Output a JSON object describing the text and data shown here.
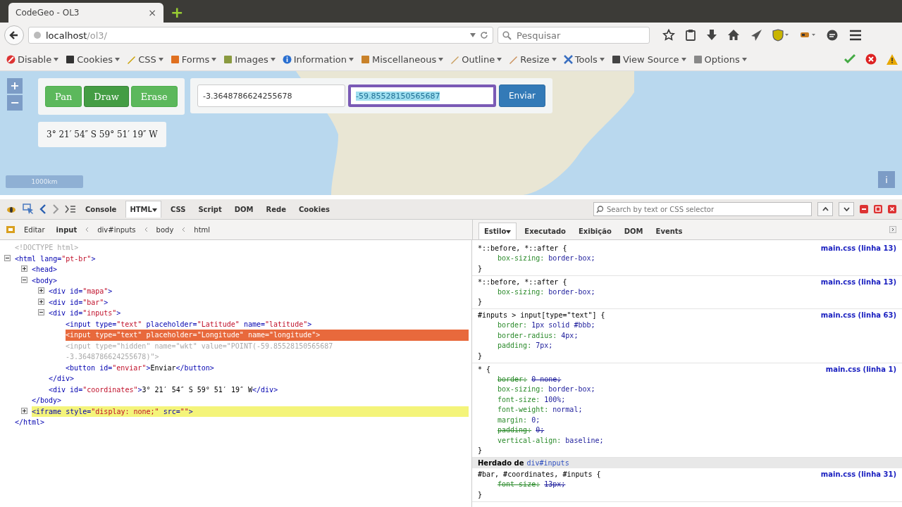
{
  "browser": {
    "tab_title": "CodeGeo - OL3",
    "tab_close": "×",
    "new_tab": "+",
    "url_host": "localhost",
    "url_path": "/ol3/",
    "search_placeholder": "Pesquisar"
  },
  "webdev_toolbar": [
    {
      "label": "Disable"
    },
    {
      "label": "Cookies"
    },
    {
      "label": "CSS"
    },
    {
      "label": "Forms"
    },
    {
      "label": "Images"
    },
    {
      "label": "Information"
    },
    {
      "label": "Miscellaneous"
    },
    {
      "label": "Outline"
    },
    {
      "label": "Resize"
    },
    {
      "label": "Tools"
    },
    {
      "label": "View Source"
    },
    {
      "label": "Options"
    }
  ],
  "map": {
    "zoom_in": "+",
    "zoom_out": "−",
    "modes": [
      {
        "label": "Pan",
        "selected": false
      },
      {
        "label": "Draw",
        "selected": true
      },
      {
        "label": "Erase",
        "selected": false
      }
    ],
    "latitude": {
      "value": "-3.3648786624255678",
      "focused": false
    },
    "longitude": {
      "value": "-59.85528150565687",
      "focused": true
    },
    "submit": "Enviar",
    "coordinates": "3° 21′ 54″ S 59° 51′ 19″ W",
    "scale": "1000km",
    "attribution": "i"
  },
  "devtools": {
    "tabs": [
      {
        "label": "Console",
        "selected": false
      },
      {
        "label": "HTML",
        "selected": true
      },
      {
        "label": "CSS",
        "selected": false
      },
      {
        "label": "Script",
        "selected": false
      },
      {
        "label": "DOM",
        "selected": false
      },
      {
        "label": "Rede",
        "selected": false
      },
      {
        "label": "Cookies",
        "selected": false
      }
    ],
    "search_placeholder": "Search by text or CSS selector",
    "edit": "Editar",
    "breadcrumbs": [
      {
        "label": "input",
        "selected": true
      },
      {
        "label": "div#inputs",
        "selected": false
      },
      {
        "label": "body",
        "selected": false
      },
      {
        "label": "html",
        "selected": false
      }
    ],
    "side_tabs": [
      {
        "label": "Estilo",
        "selected": true
      },
      {
        "label": "Executado",
        "selected": false
      },
      {
        "label": "Exibição",
        "selected": false
      },
      {
        "label": "DOM",
        "selected": false
      },
      {
        "label": "Events",
        "selected": false
      }
    ]
  },
  "html_tree": [
    {
      "line": "<!DOCTYPE html>",
      "selected": false,
      "highlighted": false,
      "dimmed": true
    },
    {
      "line": "<html lang=\"pt-br\">",
      "selected": false,
      "highlighted": false,
      "dimmed": false,
      "expanded": true,
      "close": "</html>",
      "children": [
        {
          "line": "<head>",
          "selected": false,
          "highlighted": false,
          "dimmed": false,
          "expanded": false
        },
        {
          "line": "<body>",
          "selected": false,
          "highlighted": false,
          "dimmed": false,
          "expanded": true,
          "close": "</body>",
          "children": [
            {
              "line": "<div id=\"mapa\">",
              "selected": false,
              "highlighted": false,
              "dimmed": false,
              "expanded": false
            },
            {
              "line": "<div id=\"bar\">",
              "selected": false,
              "highlighted": false,
              "dimmed": false,
              "expanded": false
            },
            {
              "line": "<div id=\"inputs\">",
              "selected": false,
              "highlighted": false,
              "dimmed": false,
              "expanded": true,
              "close": "</div>",
              "children": [
                {
                  "line": "<input type=\"text\" placeholder=\"Latitude\" name=\"latitude\">",
                  "selected": false,
                  "highlighted": false,
                  "dimmed": false
                },
                {
                  "line": "<input type=\"text\" placeholder=\"Longitude\" name=\"longitude\">",
                  "selected": true,
                  "highlighted": false,
                  "dimmed": false
                },
                {
                  "line": "<input type=\"hidden\" name=\"wkt\" value=\"POINT(-59.85528150565687 -3.3648786624255678)\">",
                  "selected": false,
                  "highlighted": false,
                  "dimmed": true
                },
                {
                  "line": "<button id=\"enviar\">Enviar</button>",
                  "selected": false,
                  "highlighted": false,
                  "dimmed": false
                }
              ]
            },
            {
              "line": "<div id=\"coordinates\">3° 21′ 54″ S 59° 51′ 19″ W</div>",
              "selected": false,
              "highlighted": false,
              "dimmed": false
            }
          ]
        },
        {
          "line": "<iframe style=\"display: none;\" src=\"\">",
          "selected": false,
          "highlighted": true,
          "dimmed": false,
          "expanded": false
        }
      ]
    }
  ],
  "css_rules": [
    {
      "kind": "rule",
      "selector": "*::before, *::after {",
      "source": "main.css (linha 13)",
      "close": "}",
      "declarations": [
        {
          "property": "box-sizing:",
          "value": "border-box;",
          "overridden": false
        }
      ]
    },
    {
      "kind": "rule",
      "selector": "*::before, *::after {",
      "source": "main.css (linha 13)",
      "close": "}",
      "declarations": [
        {
          "property": "box-sizing:",
          "value": "border-box;",
          "overridden": false
        }
      ]
    },
    {
      "kind": "rule",
      "selector": "#inputs > input[type=\"text\"] {",
      "source": "main.css (linha 63)",
      "close": "}",
      "declarations": [
        {
          "property": "border:",
          "value": "1px solid #bbb;",
          "overridden": false
        },
        {
          "property": "border-radius:",
          "value": "4px;",
          "overridden": false
        },
        {
          "property": "padding:",
          "value": "7px;",
          "overridden": false
        }
      ]
    },
    {
      "kind": "rule",
      "selector": "* {",
      "source": "main.css (linha 1)",
      "close": "}",
      "declarations": [
        {
          "property": "border:",
          "value": "0 none;",
          "overridden": true
        },
        {
          "property": "box-sizing:",
          "value": "border-box;",
          "overridden": false
        },
        {
          "property": "font-size:",
          "value": "100%;",
          "overridden": false
        },
        {
          "property": "font-weight:",
          "value": "normal;",
          "overridden": false
        },
        {
          "property": "margin:",
          "value": "0;",
          "overridden": false
        },
        {
          "property": "padding:",
          "value": "0;",
          "overridden": true
        },
        {
          "property": "vertical-align:",
          "value": "baseline;",
          "overridden": false
        }
      ]
    },
    {
      "kind": "inherited",
      "label": "Herdado de",
      "link": "div#inputs"
    },
    {
      "kind": "rule",
      "selector": "#bar, #coordinates, #inputs {",
      "source": "main.css (linha 31)",
      "close": "}",
      "declarations": [
        {
          "property": "font-size:",
          "value": "13px;",
          "overridden": true
        }
      ]
    }
  ]
}
